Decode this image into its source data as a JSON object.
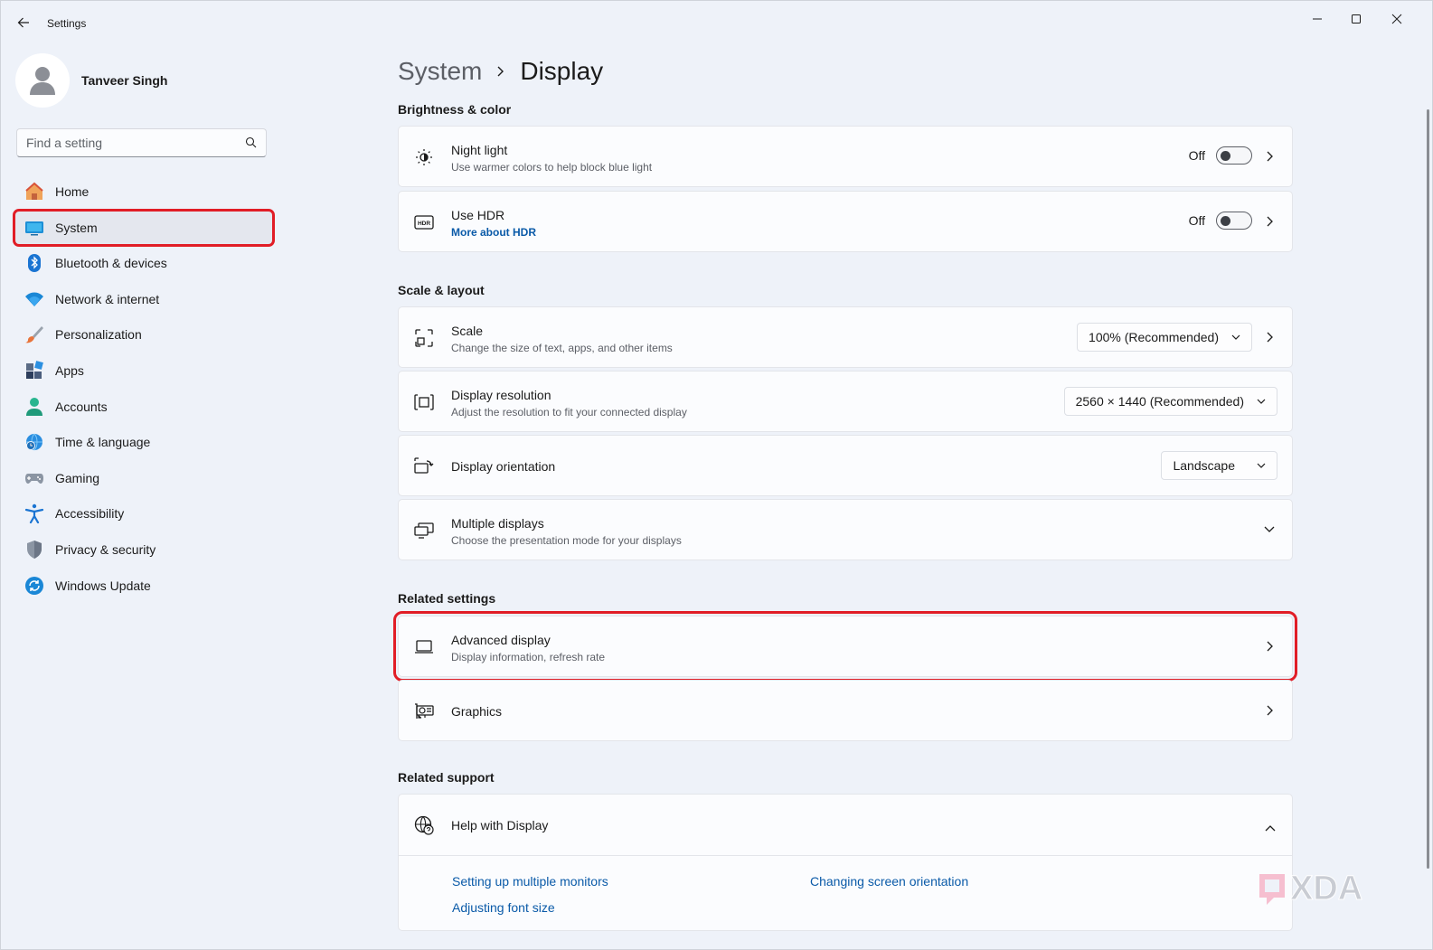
{
  "window": {
    "title": "Settings"
  },
  "profile": {
    "name": "Tanveer Singh"
  },
  "search": {
    "placeholder": "Find a setting"
  },
  "sidebar": {
    "items": [
      {
        "label": "Home",
        "icon": "home-icon"
      },
      {
        "label": "System",
        "icon": "system-icon",
        "active": true
      },
      {
        "label": "Bluetooth & devices",
        "icon": "bluetooth-icon"
      },
      {
        "label": "Network & internet",
        "icon": "wifi-icon"
      },
      {
        "label": "Personalization",
        "icon": "brush-icon"
      },
      {
        "label": "Apps",
        "icon": "apps-icon"
      },
      {
        "label": "Accounts",
        "icon": "accounts-icon"
      },
      {
        "label": "Time & language",
        "icon": "globe-clock-icon"
      },
      {
        "label": "Gaming",
        "icon": "gamepad-icon"
      },
      {
        "label": "Accessibility",
        "icon": "accessibility-icon"
      },
      {
        "label": "Privacy & security",
        "icon": "shield-icon"
      },
      {
        "label": "Windows Update",
        "icon": "update-icon"
      }
    ]
  },
  "breadcrumb": {
    "parent": "System",
    "current": "Display"
  },
  "sections": {
    "brightness": "Brightness & color",
    "scale": "Scale & layout",
    "related": "Related settings",
    "support": "Related support"
  },
  "cards": {
    "night_light": {
      "title": "Night light",
      "subtitle": "Use warmer colors to help block blue light",
      "state": "Off",
      "on": false
    },
    "hdr": {
      "title": "Use HDR",
      "link": "More about HDR",
      "state": "Off",
      "on": false
    },
    "scale": {
      "title": "Scale",
      "subtitle": "Change the size of text, apps, and other items",
      "value": "100% (Recommended)"
    },
    "resolution": {
      "title": "Display resolution",
      "subtitle": "Adjust the resolution to fit your connected display",
      "value": "2560 × 1440 (Recommended)"
    },
    "orientation": {
      "title": "Display orientation",
      "value": "Landscape"
    },
    "multiple": {
      "title": "Multiple displays",
      "subtitle": "Choose the presentation mode for your displays"
    },
    "advanced": {
      "title": "Advanced display",
      "subtitle": "Display information, refresh rate"
    },
    "graphics": {
      "title": "Graphics"
    },
    "help": {
      "title": "Help with Display",
      "links": [
        "Setting up multiple monitors",
        "Changing screen orientation",
        "Adjusting font size"
      ]
    }
  },
  "watermark": {
    "text": "XDA"
  },
  "colors": {
    "accent": "#0a5aa8",
    "highlight": "#e11d26",
    "background": "#eef2f9"
  }
}
